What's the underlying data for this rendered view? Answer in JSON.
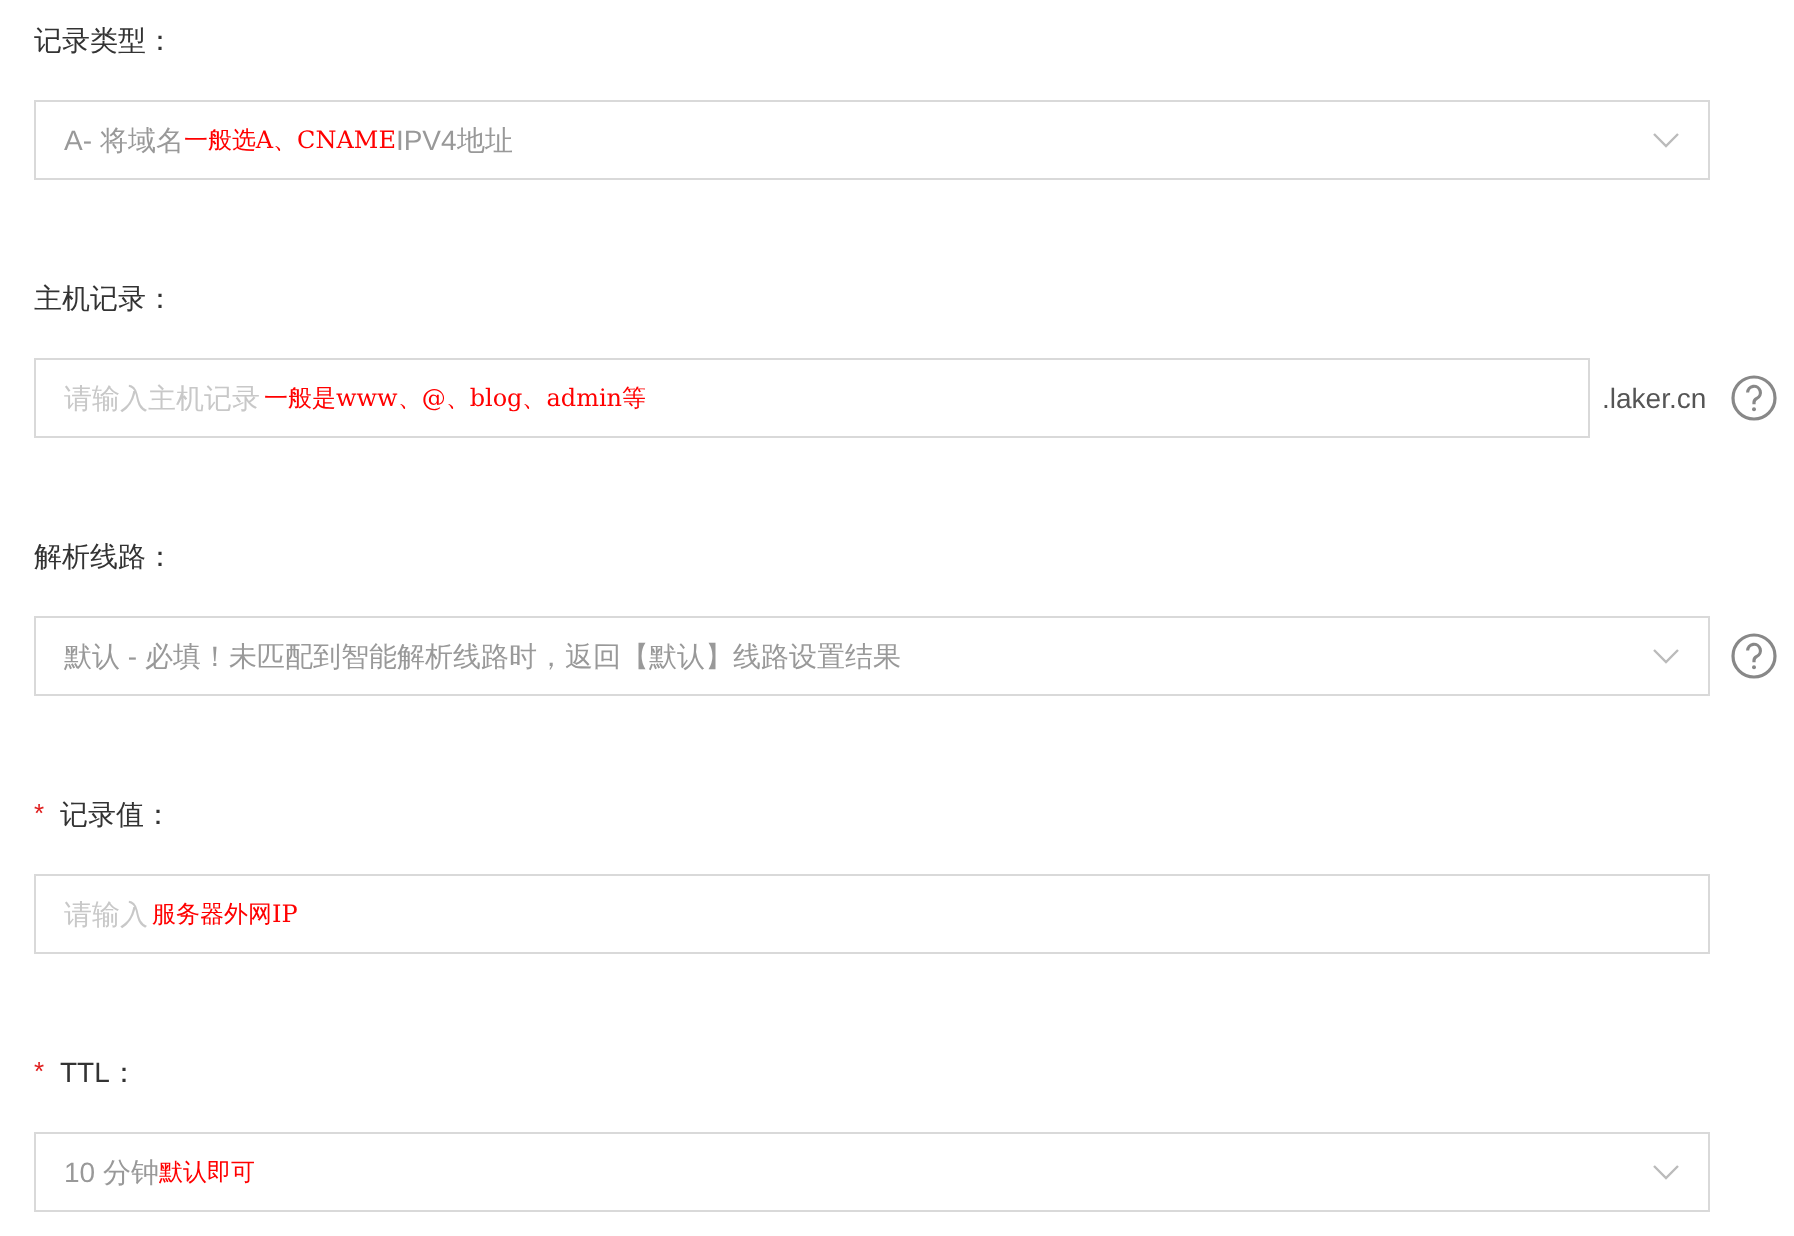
{
  "fields": [
    {
      "kind": "select",
      "label": "记录类型：",
      "value_parts": [
        "A- 将域名",
        "IPV4地址"
      ],
      "annotation": "一般选A、CNAME",
      "help": false
    },
    {
      "kind": "input",
      "label": "主机记录：",
      "placeholder": "请输入主机记录",
      "annotation": "一般是www、@、blog、admin等",
      "suffix": ".laker.cn",
      "help": true
    },
    {
      "kind": "select",
      "label": "解析线路：",
      "value_parts": [
        "默认 - 必填！未匹配到智能解析线路时，返回【默认】线路设置结果"
      ],
      "help": true
    },
    {
      "kind": "input",
      "label": "记录值：",
      "required_mark": "*",
      "placeholder": "请输入",
      "annotation": "服务器外网IP",
      "help": false
    },
    {
      "kind": "select",
      "label": "TTL：",
      "required_mark": "*",
      "value_parts": [
        "10 分钟"
      ],
      "annotation": "默认即可",
      "help": false
    }
  ]
}
